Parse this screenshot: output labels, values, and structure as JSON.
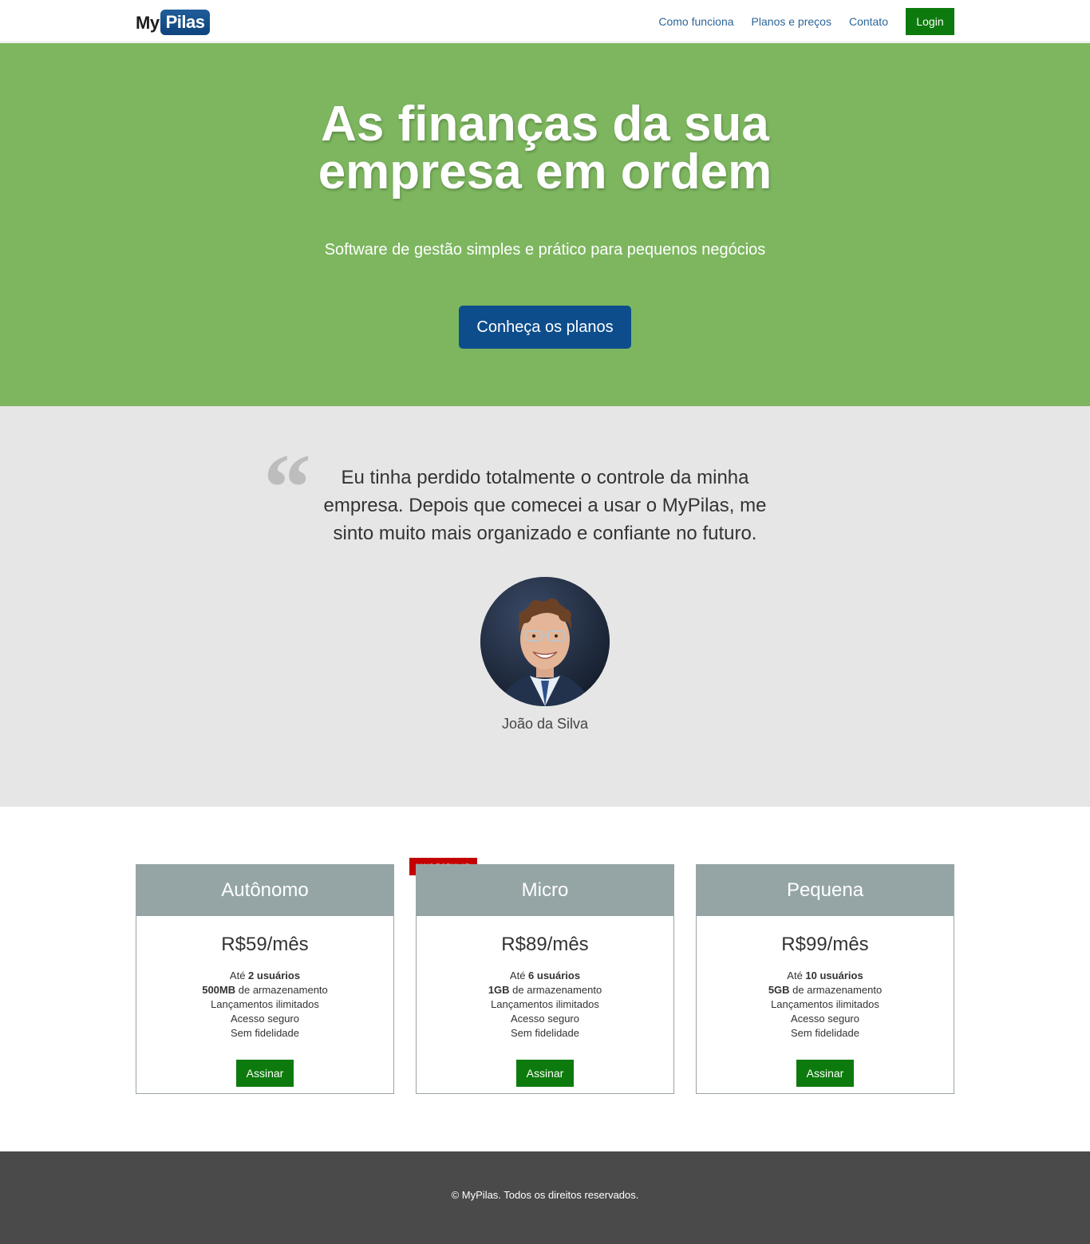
{
  "navbar": {
    "logo_my": "My",
    "logo_pilas": "Pilas",
    "links": [
      "Como funciona",
      "Planos e preços",
      "Contato"
    ],
    "login_label": "Login"
  },
  "hero": {
    "title_line1": "As finanças da sua",
    "title_line2": "empresa em ordem",
    "subtitle": "Software de gestão simples e prático para pequenos negócios",
    "cta_label": "Conheça os planos",
    "background_color": "#7db65f"
  },
  "testimonial": {
    "quote_mark": "“",
    "quote": "Eu tinha perdido totalmente o controle da minha empresa. Depois que comecei a usar o MyPilas, me sinto muito mais organizado e confiante no futuro.",
    "author": "João da Silva"
  },
  "pricing": {
    "popular_badge": "Mais popular",
    "plans": [
      {
        "name": "Autônomo",
        "price": "R$59/mês",
        "users_prefix": "Até ",
        "users": "2 usuários",
        "storage": "500MB",
        "storage_suffix": " de armazenamento",
        "features": [
          "Lançamentos ilimitados",
          "Acesso seguro",
          "Sem fidelidade"
        ],
        "button": "Assinar"
      },
      {
        "name": "Micro",
        "price": "R$89/mês",
        "users_prefix": "Até ",
        "users": "6 usuários",
        "storage": "1GB",
        "storage_suffix": " de armazenamento",
        "features": [
          "Lançamentos ilimitados",
          "Acesso seguro",
          "Sem fidelidade"
        ],
        "button": "Assinar"
      },
      {
        "name": "Pequena",
        "price": "R$99/mês",
        "users_prefix": "Até ",
        "users": "10 usuários",
        "storage": "5GB",
        "storage_suffix": " de armazenamento",
        "features": [
          "Lançamentos ilimitados",
          "Acesso seguro",
          "Sem fidelidade"
        ],
        "button": "Assinar"
      }
    ]
  },
  "footer": {
    "text": "© MyPilas. Todos os direitos reservados."
  }
}
